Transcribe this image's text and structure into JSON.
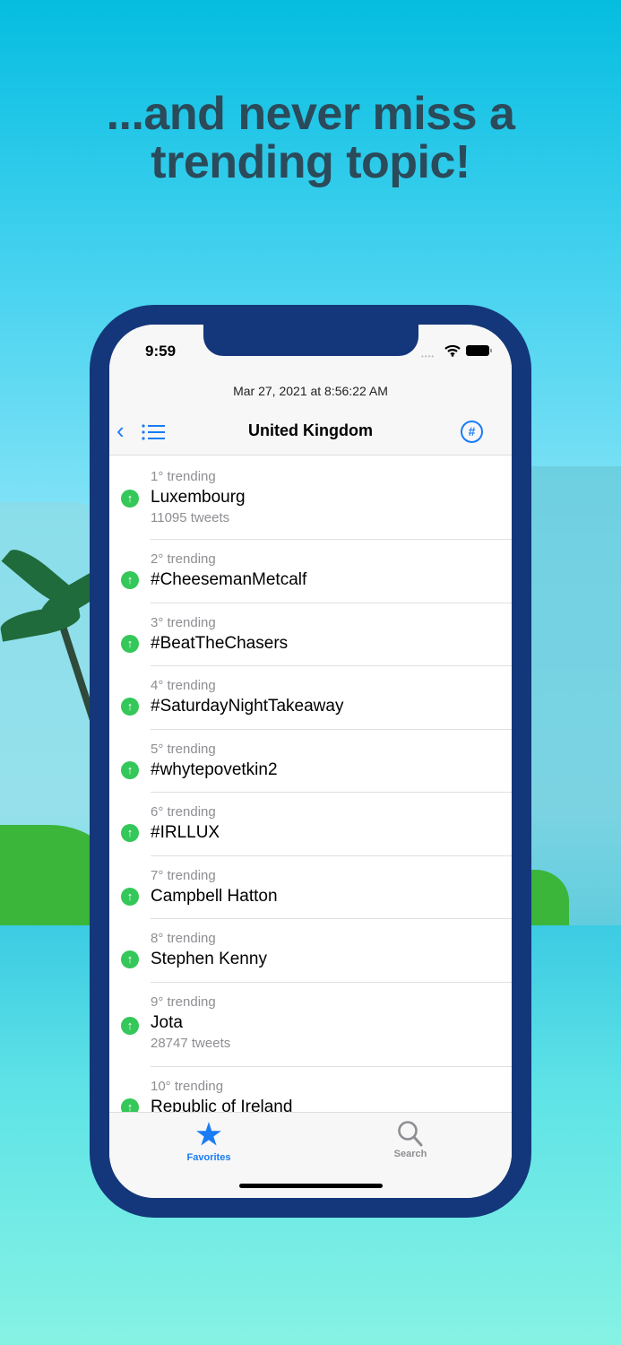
{
  "headline": {
    "line1": "...and never miss a",
    "line2": "trending topic!"
  },
  "status_bar": {
    "time": "9:59"
  },
  "header": {
    "date": "Mar 27, 2021 at 8:56:22 AM",
    "title": "United Kingdom"
  },
  "colors": {
    "accent": "#1a7cf5",
    "trend_up": "#34c759",
    "frame": "#13377a"
  },
  "trends": [
    {
      "rank": "1° trending",
      "name": "Luxembourg",
      "tweets": "11095 tweets"
    },
    {
      "rank": "2° trending",
      "name": "#CheesemanMetcalf"
    },
    {
      "rank": "3° trending",
      "name": "#BeatTheChasers"
    },
    {
      "rank": "4° trending",
      "name": "#SaturdayNightTakeaway"
    },
    {
      "rank": "5° trending",
      "name": "#whytepovetkin2"
    },
    {
      "rank": "6° trending",
      "name": "#IRLLUX"
    },
    {
      "rank": "7° trending",
      "name": "Campbell Hatton"
    },
    {
      "rank": "8° trending",
      "name": "Stephen Kenny"
    },
    {
      "rank": "9° trending",
      "name": "Jota",
      "tweets": "28747 tweets"
    },
    {
      "rank": "10° trending",
      "name": "Republic of Ireland"
    }
  ],
  "tabs": [
    {
      "label": "Favorites",
      "icon": "star-icon"
    },
    {
      "label": "Search",
      "icon": "search-icon"
    }
  ]
}
